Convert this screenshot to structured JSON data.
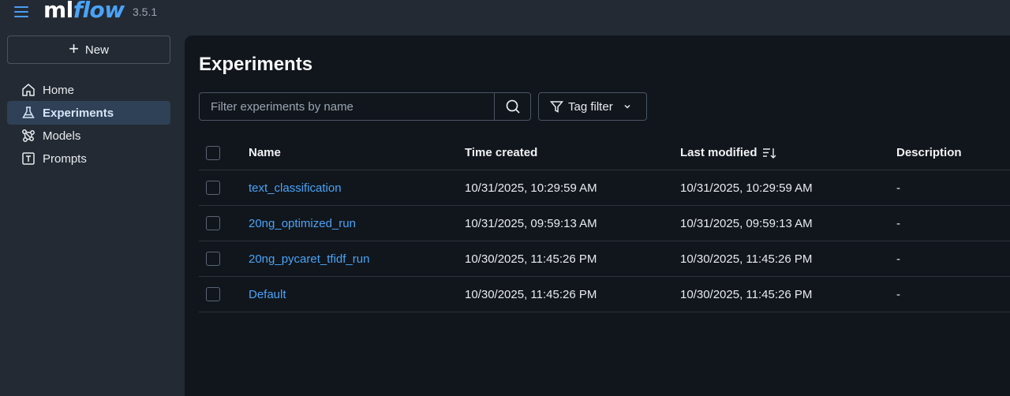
{
  "app": {
    "logo_ml": "ml",
    "logo_flow": "flow",
    "version": "3.5.1"
  },
  "sidebar": {
    "new_label": "New",
    "items": [
      {
        "label": "Home",
        "icon": "home-icon"
      },
      {
        "label": "Experiments",
        "icon": "flask-icon",
        "active": true
      },
      {
        "label": "Models",
        "icon": "models-icon"
      },
      {
        "label": "Prompts",
        "icon": "prompt-icon"
      }
    ]
  },
  "main": {
    "title": "Experiments",
    "search_placeholder": "Filter experiments by name",
    "tag_filter_label": "Tag filter"
  },
  "table": {
    "columns": [
      "Name",
      "Time created",
      "Last modified",
      "Description"
    ],
    "rows": [
      {
        "name": "text_classification",
        "created": "10/31/2025, 10:29:59 AM",
        "modified": "10/31/2025, 10:29:59 AM",
        "description": "-"
      },
      {
        "name": "20ng_optimized_run",
        "created": "10/31/2025, 09:59:13 AM",
        "modified": "10/31/2025, 09:59:13 AM",
        "description": "-"
      },
      {
        "name": "20ng_pycaret_tfidf_run",
        "created": "10/30/2025, 11:45:26 PM",
        "modified": "10/30/2025, 11:45:26 PM",
        "description": "-"
      },
      {
        "name": "Default",
        "created": "10/30/2025, 11:45:26 PM",
        "modified": "10/30/2025, 11:45:26 PM",
        "description": "-"
      }
    ]
  },
  "colors": {
    "accent": "#4aa3f7",
    "background": "#232a33",
    "panel": "#11161c",
    "active_nav": "#2f4156"
  }
}
